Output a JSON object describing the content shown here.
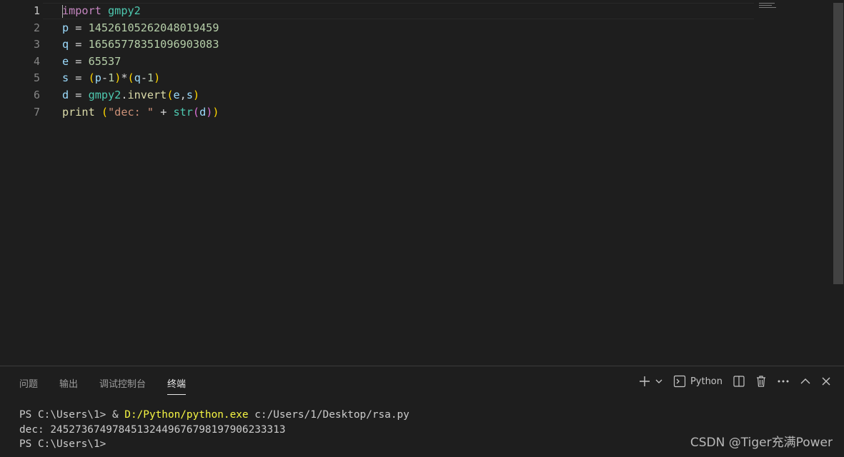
{
  "editor": {
    "line_numbers": [
      "1",
      "2",
      "3",
      "4",
      "5",
      "6",
      "7"
    ],
    "line1": {
      "kw": "import",
      "mod": "gmpy2"
    },
    "line2": {
      "var": "p",
      "op": " = ",
      "num": "14526105262048019459"
    },
    "line3": {
      "var": "q",
      "op": " = ",
      "num": "16565778351096903083"
    },
    "line4": {
      "var": "e",
      "op": " = ",
      "num": "65537"
    },
    "line5": {
      "var": "s",
      "op": " = ",
      "p1": "(",
      "a": "p",
      "m1": "-",
      "n1": "1",
      "p2": ")",
      "star": "*",
      "p3": "(",
      "b": "q",
      "m2": "-",
      "n2": "1",
      "p4": ")"
    },
    "line6": {
      "var": "d",
      "op": " = ",
      "mod": "gmpy2",
      "dot": ".",
      "fn": "invert",
      "p1": "(",
      "a": "e",
      "comma": ",",
      "b": "s",
      "p2": ")"
    },
    "line7": {
      "fn": "print",
      "sp": " ",
      "p1": "(",
      "str": "\"dec: \"",
      "plus": " + ",
      "fn2": "str",
      "p2": "(",
      "a": "d",
      "p3": ")",
      "p4": ")"
    }
  },
  "panel": {
    "tabs": [
      "问题",
      "输出",
      "调试控制台",
      "终端"
    ],
    "active_tab": "终端",
    "actions": {
      "add": "+",
      "profile": "Python"
    }
  },
  "terminal": {
    "line1_prompt": "PS C:\\Users\\1> ",
    "line1_amp": "& ",
    "line1_exe": "D:/Python/python.exe",
    "line1_arg": " c:/Users/1/Desktop/rsa.py",
    "line2": "dec: 24527367497845132449676798197906233313",
    "line3": "PS C:\\Users\\1> "
  },
  "watermark": "CSDN @Tiger充满Power"
}
